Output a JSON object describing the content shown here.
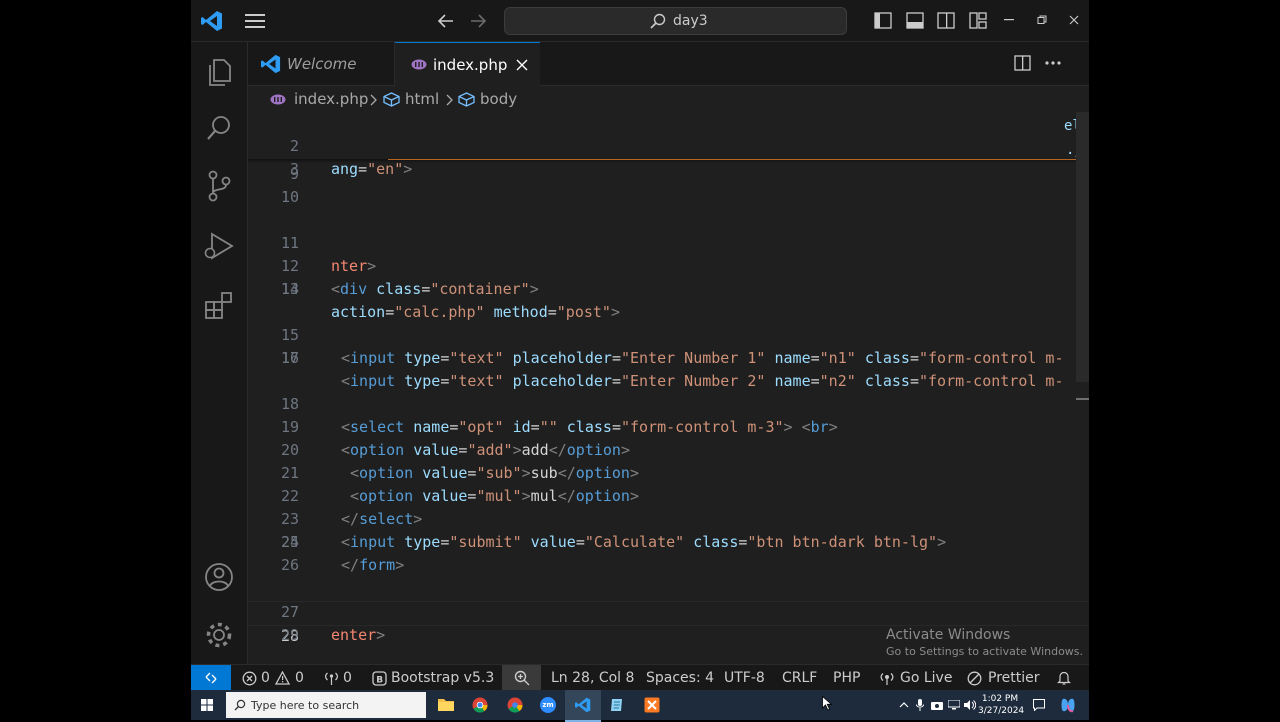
{
  "titlebar": {
    "search_text": "day3"
  },
  "tabs": [
    {
      "label": "Welcome"
    },
    {
      "label": "index.php"
    }
  ],
  "breadcrumb": {
    "file": "index.php",
    "seg1": "html",
    "seg2": "body"
  },
  "minimap_fragment": {
    "a": "el",
    "b": ".j"
  },
  "lines": {
    "l2": "2",
    "l3": "3",
    "l9": "9",
    "l10": "10",
    "l11": "11",
    "l12": "12",
    "l13": "13",
    "l14": "14",
    "l15": "15",
    "l16": "16",
    "l17": "17",
    "l18": "18",
    "l19": "19",
    "l20": "20",
    "l21": "21",
    "l22": "22",
    "l23": "23",
    "l24": "24",
    "l25": "25",
    "l26": "26",
    "l27": "27",
    "l28": "28",
    "l29": "29"
  },
  "code": {
    "c2_attr": "ang",
    "c2_val": "\"en\"",
    "c11_tag": "nter",
    "c12_tag": "div",
    "c12_attr": "class",
    "c12_val": "\"container\"",
    "c13_attr1": "action",
    "c13_val1": "\"calc.php\"",
    "c13_attr2": "method",
    "c13_val2": "\"post\"",
    "c15_tag": "input",
    "c15_a1": "type",
    "c15_v1": "\"text\"",
    "c15_a2": "placeholder",
    "c15_v2": "\"Enter Number 1\"",
    "c15_a3": "name",
    "c15_v3": "\"n1\"",
    "c15_a4": "class",
    "c15_v4": "\"form-control m-",
    "c16_tag": "input",
    "c16_a1": "type",
    "c16_v1": "\"text\"",
    "c16_a2": "placeholder",
    "c16_v2": "\"Enter Number 2\"",
    "c16_a3": "name",
    "c16_v3": "\"n2\"",
    "c16_a4": "class",
    "c16_v4": "\"form-control m-",
    "c18_tag": "select",
    "c18_a1": "name",
    "c18_v1": "\"opt\"",
    "c18_a2": "id",
    "c18_v2": "\"\"",
    "c18_a3": "class",
    "c18_v3": "\"form-control m-3\"",
    "c18_tag2": "br",
    "c19_tag": "option",
    "c19_a1": "value",
    "c19_v1": "\"add\"",
    "c19_text": "add",
    "c19_close": "option",
    "c20_tag": "option",
    "c20_a1": "value",
    "c20_v1": "\"sub\"",
    "c20_text": "sub",
    "c20_close": "option",
    "c21_tag": "option",
    "c21_a1": "value",
    "c21_v1": "\"mul\"",
    "c21_text": "mul",
    "c21_close": "option",
    "c22_close": "select",
    "c23_tag": "input",
    "c23_a1": "type",
    "c23_v1": "\"submit\"",
    "c23_a2": "value",
    "c23_v2": "\"Calculate\"",
    "c23_a3": "class",
    "c23_v3": "\"btn btn-dark btn-lg\"",
    "c24_close": "form",
    "c27_tag": "enter"
  },
  "statusbar": {
    "errors": "0",
    "warnings": "0",
    "ports": "0",
    "bootstrap": "Bootstrap v5.3",
    "position": "Ln 28, Col 8",
    "spaces": "Spaces: 4",
    "encoding": "UTF-8",
    "eol": "CRLF",
    "language": "PHP",
    "golive": "Go Live",
    "prettier": "Prettier"
  },
  "watermark": {
    "title": "Activate Windows",
    "subtitle": "Go to Settings to activate Windows."
  },
  "taskbar": {
    "search_placeholder": "Type here to search",
    "time": "1:02 PM",
    "date": "3/27/2024",
    "zoom_label": "zm"
  },
  "colors": {
    "accent": "#0078d4",
    "editor_bg": "#1f1f1f",
    "chrome_bg": "#181818"
  }
}
